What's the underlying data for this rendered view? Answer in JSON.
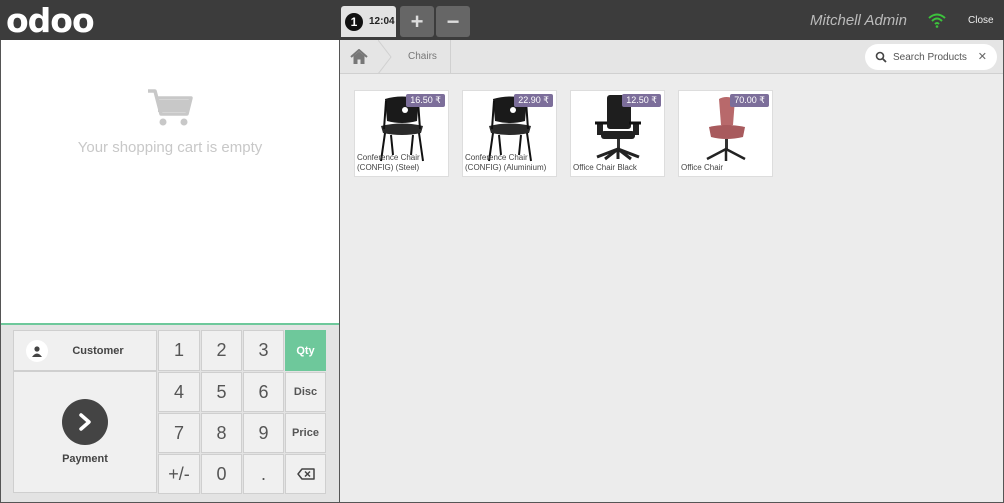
{
  "app": {
    "logo_text": "odoo"
  },
  "header": {
    "order": {
      "number": "1",
      "time": "12:04"
    },
    "add_order_symbol": "+",
    "remove_order_symbol": "−",
    "user_name": "Mitchell Admin",
    "close_label": "Close",
    "wifi_color": "#3cc33c"
  },
  "cart": {
    "empty_message": "Your shopping cart is empty"
  },
  "pad": {
    "customer_label": "Customer",
    "payment_label": "Payment",
    "keys": [
      "1",
      "2",
      "3",
      "4",
      "5",
      "6",
      "7",
      "8",
      "9",
      "+/-",
      "0",
      "."
    ],
    "modes": [
      "Qty",
      "Disc",
      "Price"
    ],
    "active_mode": "Qty",
    "accent_color": "#6ec89b"
  },
  "breadcrumb": {
    "category": "Chairs"
  },
  "search": {
    "placeholder": "Search Products"
  },
  "products": [
    {
      "name": "Conference Chair (CONFIG) (Steel)",
      "price": "16.50 ₹",
      "icon": "conference-chair"
    },
    {
      "name": "Conference Chair (CONFIG) (Aluminium)",
      "price": "22.90 ₹",
      "icon": "conference-chair"
    },
    {
      "name": "Office Chair Black",
      "price": "12.50 ₹",
      "icon": "office-chair-black"
    },
    {
      "name": "Office Chair",
      "price": "70.00 ₹",
      "icon": "office-chair-pink"
    }
  ]
}
